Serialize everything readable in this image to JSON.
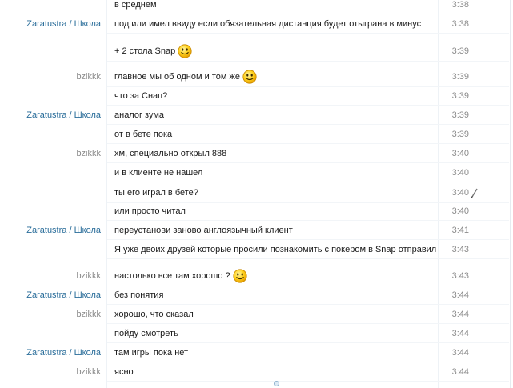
{
  "messages": [
    {
      "sender": "",
      "text": "в среднем",
      "time": "3:38",
      "smiley": false
    },
    {
      "sender": "Zaratustra / Школа",
      "text": "под или имел ввиду если обязательная дистанция будет отыграна в минус",
      "time": "3:38",
      "smiley": false
    },
    {
      "sender": "",
      "text": "+ 2 стола Snap",
      "time": "3:39",
      "smiley": true
    },
    {
      "sender": "bzikkk",
      "text": "главное мы об одном и том же",
      "time": "3:39",
      "smiley": true
    },
    {
      "sender": "",
      "text": "что за Снап?",
      "time": "3:39",
      "smiley": false
    },
    {
      "sender": "Zaratustra / Школа",
      "text": "аналог зума",
      "time": "3:39",
      "smiley": false
    },
    {
      "sender": "",
      "text": "от в бете пока",
      "time": "3:39",
      "smiley": false
    },
    {
      "sender": "bzikkk",
      "text": "хм, специально открыл 888",
      "time": "3:40",
      "smiley": false
    },
    {
      "sender": "",
      "text": "и в клиенте не нашел",
      "time": "3:40",
      "smiley": false
    },
    {
      "sender": "",
      "text": "ты его играл в бете?",
      "time": "3:40",
      "smiley": false
    },
    {
      "sender": "",
      "text": "или просто читал",
      "time": "3:40",
      "smiley": false
    },
    {
      "sender": "Zaratustra / Школа",
      "text": "переустанови заново англоязычный клиент",
      "time": "3:41",
      "smiley": false
    },
    {
      "sender": "",
      "text": "Я уже двоих друзей которые просили познакомить с покером в Snap отправил",
      "time": "3:43",
      "smiley": false
    },
    {
      "sender": "bzikkk",
      "text": "настолько все там хорошо ?",
      "time": "3:43",
      "smiley": true
    },
    {
      "sender": "Zaratustra / Школа",
      "text": "без понятия",
      "time": "3:44",
      "smiley": false
    },
    {
      "sender": "bzikkk",
      "text": "хорошо, что сказал",
      "time": "3:44",
      "smiley": false
    },
    {
      "sender": "",
      "text": "пойду смотреть",
      "time": "3:44",
      "smiley": false
    },
    {
      "sender": "Zaratustra / Школа",
      "text": "там игры пока нет",
      "time": "3:44",
      "smiley": false
    },
    {
      "sender": "bzikkk",
      "text": "ясно",
      "time": "3:44",
      "smiley": false
    }
  ],
  "icons": {
    "smiley": "smiley-emoticon-icon",
    "edit": "edit-pencil-icon",
    "scroll": "scroll-indicator-icon"
  },
  "colors": {
    "sender_zaratustra": "#2a6d9a",
    "sender_bzikkk": "#8a8a8a",
    "message_text": "#1a1a1a",
    "timestamp": "#8a8a8a"
  }
}
